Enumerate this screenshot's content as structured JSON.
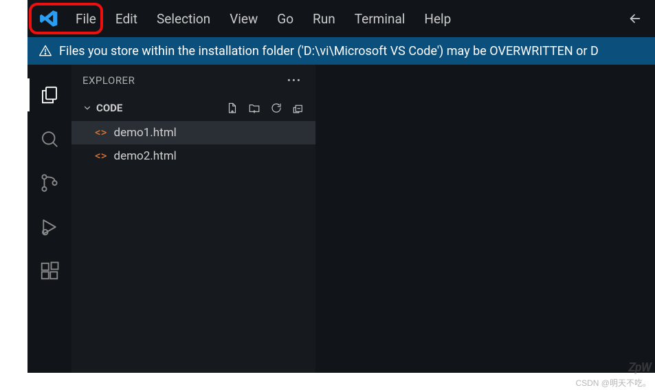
{
  "menu": {
    "items": [
      "File",
      "Edit",
      "Selection",
      "View",
      "Go",
      "Run",
      "Terminal",
      "Help"
    ]
  },
  "info_banner": {
    "text": "Files you store within the installation folder ('D:\\vi\\Microsoft VS Code') may be OVERWRITTEN or D"
  },
  "sidebar": {
    "title": "EXPLORER",
    "section_label": "CODE",
    "files": [
      {
        "name": "demo1.html",
        "active": true
      },
      {
        "name": "demo2.html",
        "active": false
      }
    ]
  },
  "activity": {
    "items": [
      {
        "key": "explorer",
        "active": true
      },
      {
        "key": "search",
        "active": false
      },
      {
        "key": "scm",
        "active": false
      },
      {
        "key": "debug",
        "active": false
      },
      {
        "key": "extensions",
        "active": false
      }
    ]
  },
  "watermark": {
    "site": "CSDN @明天不吃。",
    "brand": "ZpW"
  },
  "colors": {
    "banner_bg": "#0b4f7c",
    "highlight_border": "#ee0f0f",
    "file_icon": "#e37933",
    "logo": "#2a9df4"
  }
}
